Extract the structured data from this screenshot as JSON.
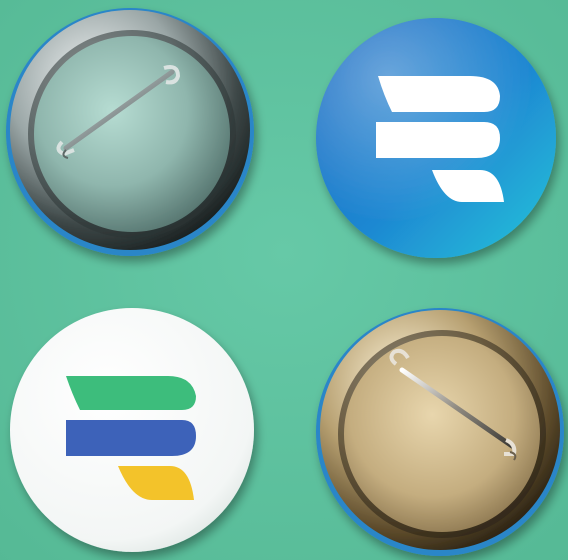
{
  "scene": {
    "background": "#5fc3a0",
    "badges": [
      {
        "kind": "back",
        "finish": "silver-pin-back"
      },
      {
        "kind": "front",
        "finish": "blue-gradient",
        "logo": "white-r-mark"
      },
      {
        "kind": "front",
        "finish": "white",
        "logo": "tricolor-r-mark"
      },
      {
        "kind": "back",
        "finish": "gold-pin-back"
      }
    ]
  },
  "colors": {
    "background": "#5fc3a0",
    "blue_badge_dark": "#1565c0",
    "blue_badge_light": "#26c6da",
    "logo_green": "#3dbd7c",
    "logo_blue": "#3d62b9",
    "logo_yellow": "#f3c32b",
    "white": "#ffffff"
  }
}
